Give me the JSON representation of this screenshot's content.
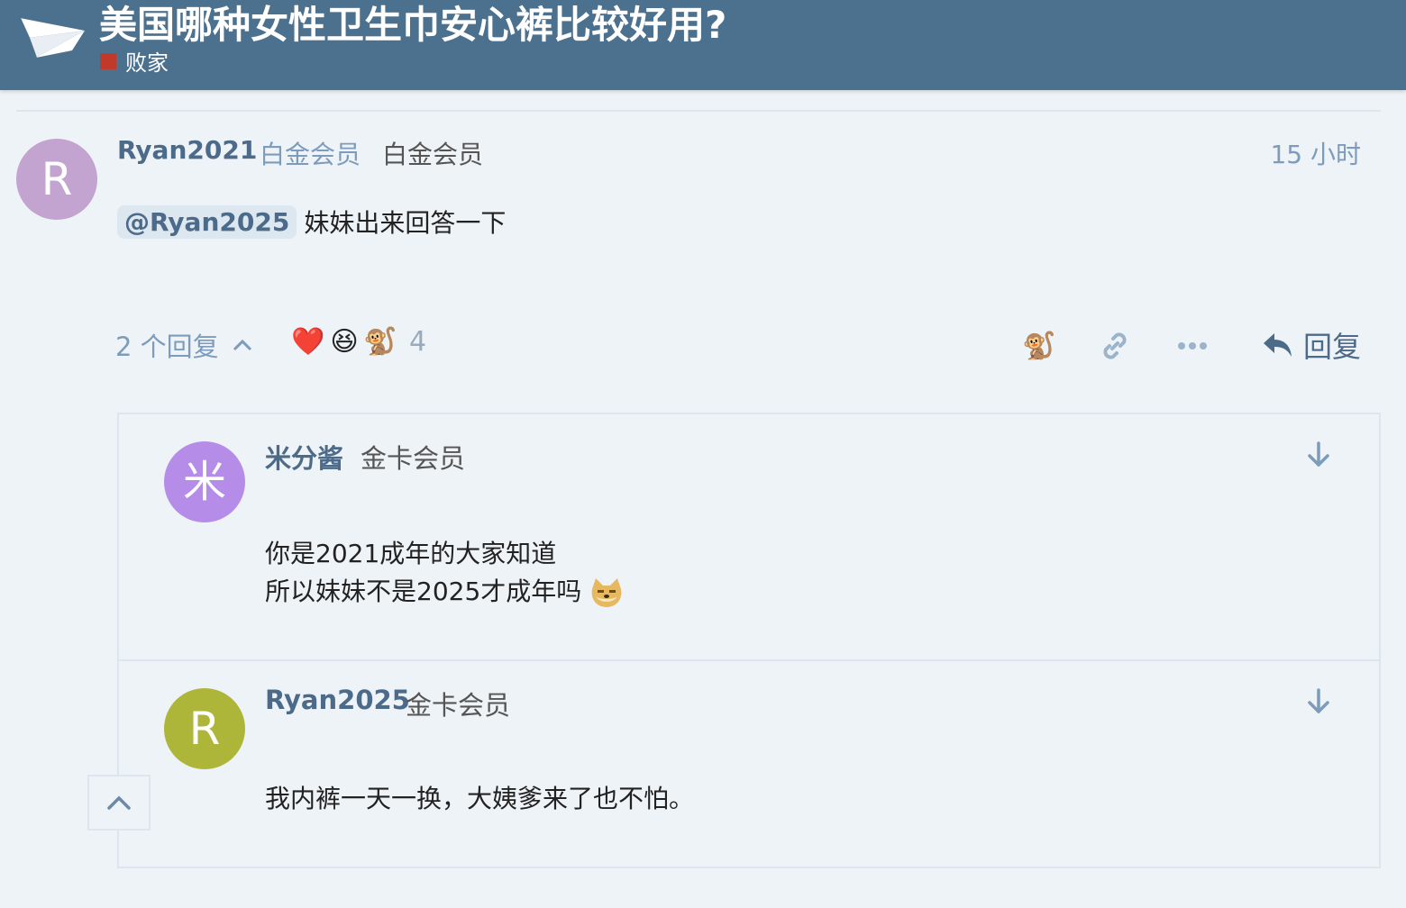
{
  "header": {
    "topic_title": "美国哪种女性卫生巾安心裤比较好用?",
    "category": {
      "name": "败家",
      "color": "#c0392b"
    },
    "logo_icon": "paper-plane-logo",
    "bar_color": "#4c718e"
  },
  "post": {
    "avatar_letter": "R",
    "avatar_color": "#c3a3cf",
    "username": "Ryan2021",
    "title": "白金会员",
    "badge": "白金会员",
    "time": "15 小时",
    "mention": "@Ryan2025",
    "text": "妹妹出来回答一下",
    "replies_label": "2 个回复",
    "reactions": [
      "❤️",
      "😆",
      "🐒"
    ],
    "reaction_count": "4",
    "reply_label": "回复",
    "icons": [
      "monkey-react-icon",
      "link-icon",
      "more-icon",
      "reply-arrow-icon"
    ]
  },
  "embedded_replies": [
    {
      "avatar_letter": "米",
      "avatar_color": "#b58de8",
      "username": "米分酱",
      "title": "金卡会员",
      "lines": [
        "你是2021成年的大家知道",
        "所以妹妹不是2025才成年吗"
      ],
      "emoji_icon": "doge-icon"
    },
    {
      "avatar_letter": "R",
      "avatar_color": "#aeb63a",
      "username": "Ryan2025",
      "title": "金卡会员",
      "lines": [
        "我内裤一天一换，大姨爹来了也不怕。"
      ]
    }
  ],
  "accent_color": "#4c6a8a",
  "muted_color": "#7d9bbb"
}
